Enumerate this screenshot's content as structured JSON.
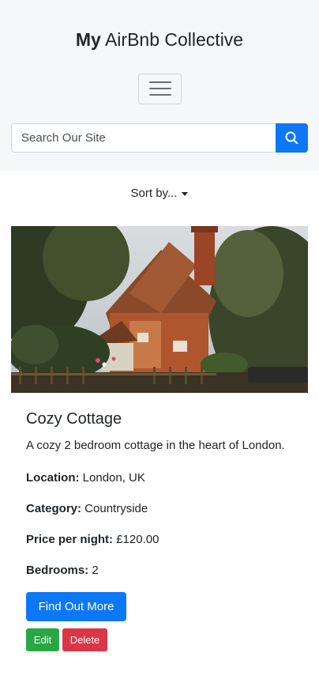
{
  "header": {
    "brand_strong": "My",
    "brand_rest": " AirBnb Collective"
  },
  "search": {
    "placeholder": "Search Our Site",
    "value": ""
  },
  "sort": {
    "label": "Sort by..."
  },
  "listing": {
    "image_subject": "cottage-photo",
    "title": "Cozy Cottage",
    "description": "A cozy 2 bedroom cottage in the heart of London.",
    "location_label": "Location:",
    "location_value": " London, UK",
    "category_label": "Category:",
    "category_value": " Countryside",
    "price_label": "Price per night:",
    "price_value": " £120.00",
    "bedrooms_label": "Bedrooms:",
    "bedrooms_value": " 2",
    "find_out_more": "Find Out More",
    "edit": "Edit",
    "delete": "Delete"
  },
  "colors": {
    "primary": "#0d78f5",
    "success": "#28a745",
    "danger": "#dc3545",
    "header_bg": "#f6f7f9"
  },
  "icons": {
    "menu": "hamburger-icon",
    "search": "search-icon",
    "sort": "caret-down-icon"
  }
}
